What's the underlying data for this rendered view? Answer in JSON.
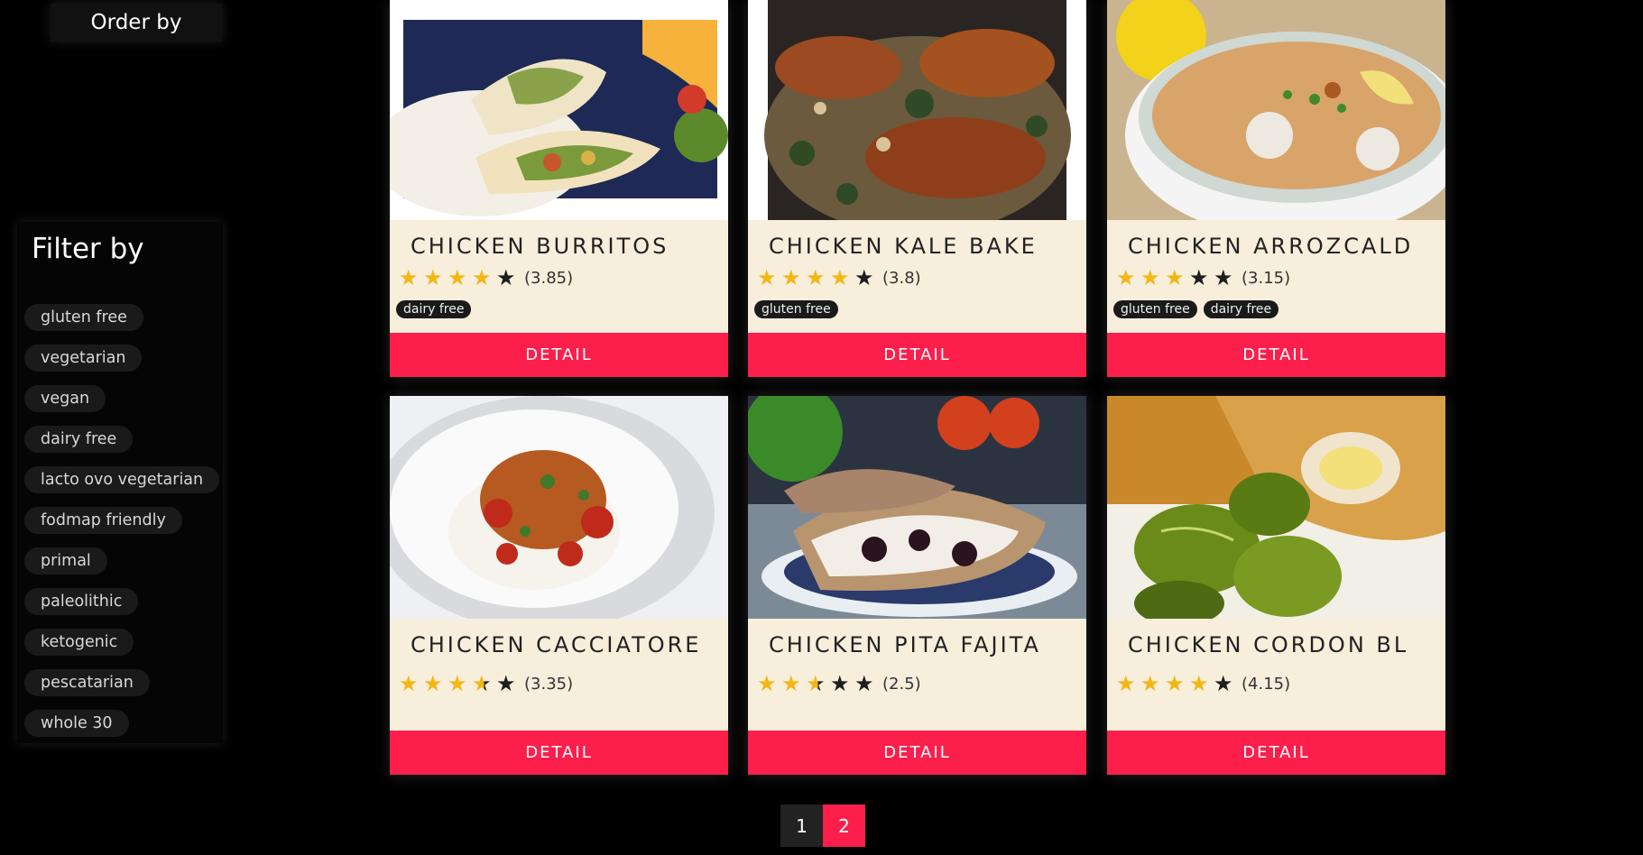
{
  "order_by": {
    "label": "Order by"
  },
  "filter": {
    "title": "Filter by",
    "options": [
      "gluten free",
      "vegetarian",
      "vegan",
      "dairy free",
      "lacto ovo vegetarian",
      "fodmap friendly",
      "primal",
      "paleolithic",
      "ketogenic",
      "pescatarian",
      "whole 30"
    ]
  },
  "cards": [
    {
      "title": "CHICKEN BURRITOS",
      "rating": 3.85,
      "rating_label": "(3.85)",
      "tags": [
        "dairy free"
      ],
      "detail_label": "DETAIL",
      "image": "chicken-burritos-photo"
    },
    {
      "title": "CHICKEN KALE BAKE",
      "rating": 3.8,
      "rating_label": "(3.8)",
      "tags": [
        "gluten free"
      ],
      "detail_label": "DETAIL",
      "image": "chicken-kale-bake-photo"
    },
    {
      "title": "CHICKEN ARROZCALD",
      "rating": 3.15,
      "rating_label": "(3.15)",
      "tags": [
        "gluten free",
        "dairy free"
      ],
      "detail_label": "DETAIL",
      "image": "chicken-arrozcaldo-photo"
    },
    {
      "title": "CHICKEN CACCIATORE",
      "rating": 3.35,
      "rating_label": "(3.35)",
      "tags": [],
      "detail_label": "DETAIL",
      "image": "chicken-cacciatore-photo"
    },
    {
      "title": "CHICKEN PITA FAJITA",
      "rating": 2.5,
      "rating_label": "(2.5)",
      "tags": [],
      "detail_label": "DETAIL",
      "image": "chicken-pita-fajita-photo"
    },
    {
      "title": "CHICKEN CORDON BL",
      "rating": 4.15,
      "rating_label": "(4.15)",
      "tags": [],
      "detail_label": "DETAIL",
      "image": "chicken-cordon-bleu-photo"
    }
  ],
  "pagination": {
    "pages": [
      "1",
      "2"
    ],
    "current": "2"
  },
  "colors": {
    "accent": "#fc1f4c",
    "card_bg": "#f8eedc",
    "star": "#f4b615"
  }
}
